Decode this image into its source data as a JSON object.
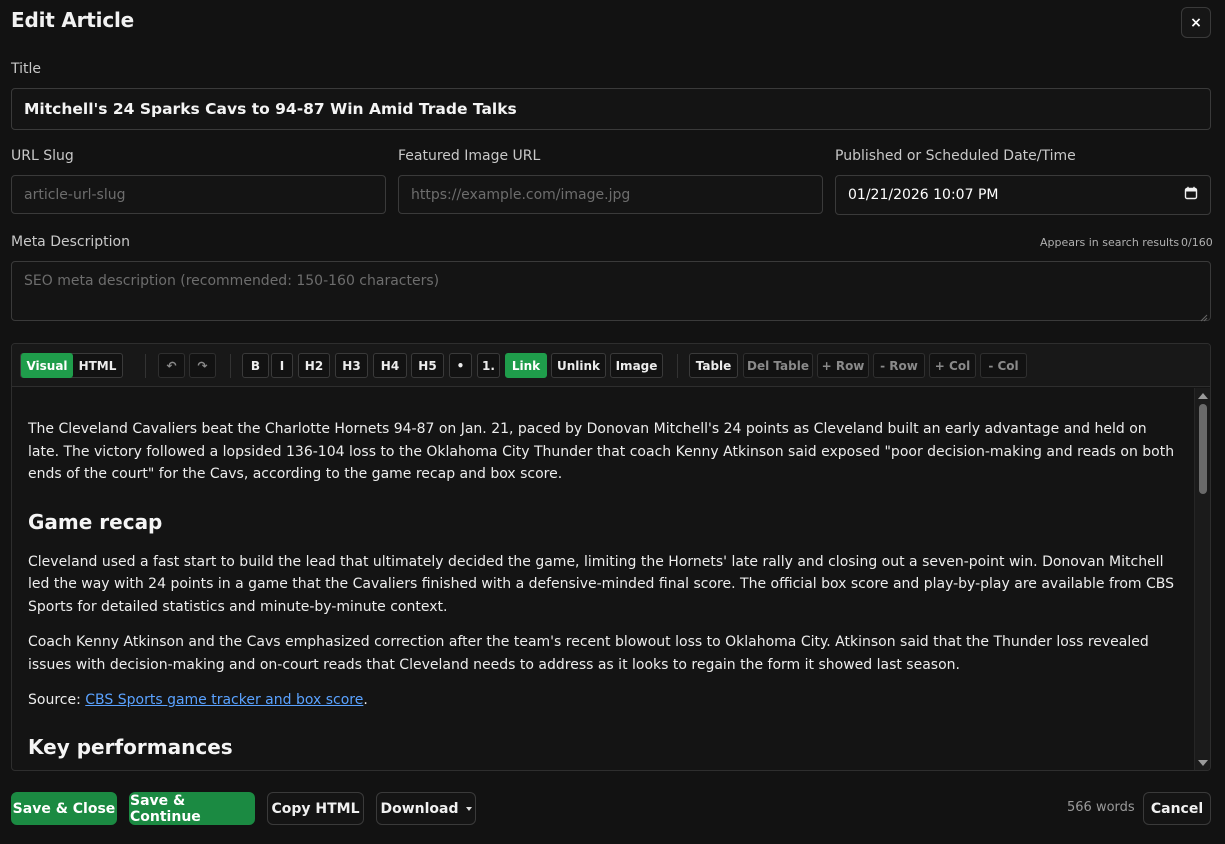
{
  "header": {
    "title": "Edit Article",
    "close_label": "×"
  },
  "form": {
    "title_label": "Title",
    "title_value": "Mitchell's 24 Sparks Cavs to 94-87 Win Amid Trade Talks",
    "slug_label": "URL Slug",
    "slug_placeholder": "article-url-slug",
    "image_label": "Featured Image URL",
    "image_placeholder": "https://example.com/image.jpg",
    "date_label": "Published or Scheduled Date/Time",
    "date_value": "01/21/2026 10:07 PM",
    "meta_label": "Meta Description",
    "meta_hint": "Appears in search results",
    "meta_count": "0/160",
    "meta_placeholder": "SEO meta description (recommended: 150-160 characters)"
  },
  "toolbar": {
    "mode_visual": "Visual",
    "mode_html": "HTML",
    "undo": "↶",
    "redo": "↷",
    "bold": "B",
    "italic": "I",
    "h2": "H2",
    "h3": "H3",
    "h4": "H4",
    "h5": "H5",
    "bullet": "•",
    "numbered": "1.",
    "link": "Link",
    "unlink": "Unlink",
    "image": "Image",
    "table": "Table",
    "del_table": "Del Table",
    "add_row": "+ Row",
    "del_row": "- Row",
    "add_col": "+ Col",
    "del_col": "- Col"
  },
  "content": {
    "intro": "The Cleveland Cavaliers beat the Charlotte Hornets 94-87 on Jan. 21, paced by Donovan Mitchell's 24 points as Cleveland built an early advantage and held on late. The victory followed a lopsided 136-104 loss to the Oklahoma City Thunder that coach Kenny Atkinson said exposed \"poor decision-making and reads on both ends of the court\" for the Cavs, according to the game recap and box score.",
    "heading1": "Game recap",
    "para2": "Cleveland used a fast start to build the lead that ultimately decided the game, limiting the Hornets' late rally and closing out a seven-point win. Donovan Mitchell led the way with 24 points in a game that the Cavaliers finished with a defensive-minded final score. The official box score and play-by-play are available from CBS Sports for detailed statistics and minute-by-minute context.",
    "para3": "Coach Kenny Atkinson and the Cavs emphasized correction after the team's recent blowout loss to Oklahoma City. Atkinson said that the Thunder loss revealed issues with decision-making and on-court reads that Cleveland needs to address as it looks to regain the form it showed last season.",
    "source_prefix": "Source: ",
    "source_link": "CBS Sports game tracker and box score",
    "source_suffix": ".",
    "heading2": "Key performances"
  },
  "footer": {
    "save_close": "Save & Close",
    "save_continue": "Save & Continue",
    "copy_html": "Copy HTML",
    "download": "Download",
    "word_count": "566 words",
    "cancel": "Cancel"
  },
  "colors": {
    "accent": "#1f9d4b",
    "link": "#5aa2ff",
    "background": "#121212"
  }
}
